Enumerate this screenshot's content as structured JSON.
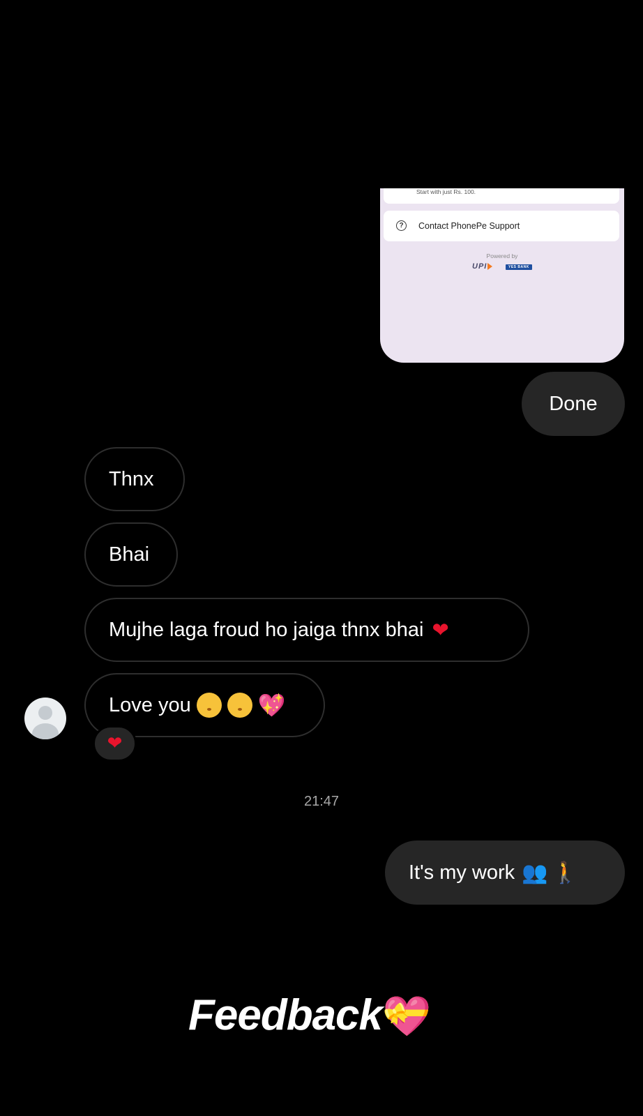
{
  "shared_card": {
    "top_row_text": "Start with just Rs. 100.",
    "support_label": "Contact PhonePe Support",
    "powered_by": "Powered by",
    "upi_logo_text": "UPI",
    "bank_logo_text": "YES BANK"
  },
  "messages": {
    "done": "Done",
    "thnx": "Thnx",
    "bhai": "Bhai",
    "mujhe": "Mujhe laga froud ho jaiga thnx bhai",
    "love": "Love you",
    "work": "It's my work"
  },
  "emojis": {
    "red_heart": "❤",
    "sparkle_heart": "💖",
    "reaction": "❤",
    "people": "👥",
    "walk": "🚶"
  },
  "timestamp": "21:47",
  "caption": {
    "text": "Feedback",
    "emoji": "💝"
  },
  "colors": {
    "background": "#000000",
    "sent_bubble": "#262626",
    "received_border": "#2e2e2e",
    "card_background": "#ece4f1"
  }
}
